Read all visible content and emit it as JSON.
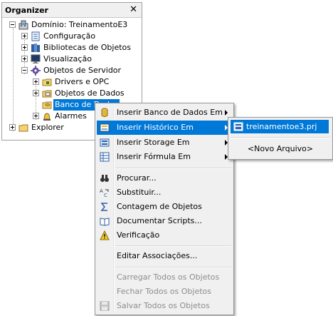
{
  "organizer": {
    "title": "Organizer",
    "close_glyph": "✕",
    "tree": {
      "root": "Domínio: TreinamentoE3",
      "configuracao": "Configuração",
      "bibliotecas": "Bibliotecas de Objetos",
      "visualizacao": "Visualização",
      "objetos_servidor": "Objetos de Servidor",
      "drivers": "Drivers e OPC",
      "objetos_dados": "Objetos de Dados",
      "banco": "Banco de Dados",
      "alarmes": "Alarmes",
      "explorer": "Explorer"
    }
  },
  "context_menu": {
    "items": [
      {
        "label": "Inserir Banco de Dados Em",
        "icon": "database-icon",
        "submenu": true
      },
      {
        "label": "Inserir Histórico Em",
        "icon": "history-icon",
        "submenu": true,
        "active": true
      },
      {
        "label": "Inserir Storage Em",
        "icon": "storage-icon",
        "submenu": true
      },
      {
        "label": "Inserir Fórmula Em",
        "icon": "formula-icon",
        "submenu": true
      },
      {
        "label": "Procurar...",
        "icon": "binoculars-icon"
      },
      {
        "label": "Substituir...",
        "icon": "replace-icon"
      },
      {
        "label": "Contagem de Objetos",
        "icon": "sigma-icon"
      },
      {
        "label": "Documentar Scripts...",
        "icon": "book-icon"
      },
      {
        "label": "Verificação",
        "icon": "warning-icon"
      },
      {
        "label": "Editar Associações..."
      },
      {
        "label": "Carregar Todos os Objetos",
        "disabled": true
      },
      {
        "label": "Fechar Todos os Objetos",
        "disabled": true
      },
      {
        "label": "Salvar Todos os Objetos",
        "icon": "save-icon",
        "disabled": true
      }
    ]
  },
  "submenu": {
    "file": "treinamentoe3.prj",
    "new_file": "<Novo Arquivo>"
  },
  "colors": {
    "selection": "#0078d7",
    "menu_bg": "#f0f0f0",
    "disabled_text": "#8d8d8d"
  }
}
